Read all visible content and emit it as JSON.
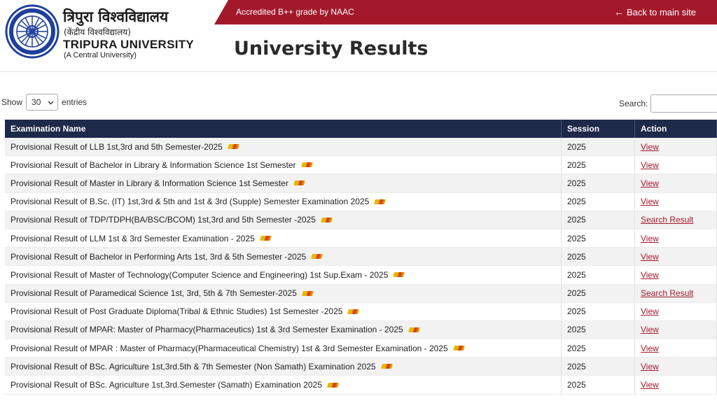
{
  "header": {
    "hindi_name": "त्रिपुरा विश्वविद्यालय",
    "hindi_sub": "(केंद्रीय विश्वविद्यालय)",
    "english_name": "TRIPURA UNIVERSITY",
    "english_sub": "(A Central University)",
    "naac": "Accredited B++ grade by NAAC",
    "back_label": "Back to main site",
    "page_title": "University Results"
  },
  "controls": {
    "show_label": "Show",
    "entries_value": "30",
    "entries_label": "entries",
    "search_label": "Search:"
  },
  "table": {
    "headers": [
      "Examination Name",
      "Session",
      "Action"
    ],
    "rows": [
      {
        "name": "Provisional Result of LLB 1st,3rd and 5th Semester-2025",
        "session": "2025",
        "action": "View"
      },
      {
        "name": "Provisional Result of Bachelor in Library & Information Science 1st Semester",
        "session": "2025",
        "action": "View"
      },
      {
        "name": "Provisional Result of Master in Library & Information Science 1st Semester",
        "session": "2025",
        "action": "View"
      },
      {
        "name": "Provisional Result of B.Sc. (IT) 1st,3rd & 5th and 1st & 3rd (Supple) Semester Examination 2025",
        "session": "2025",
        "action": "View"
      },
      {
        "name": "Provisional Result of TDP/TDPH(BA/BSC/BCOM) 1st,3rd and 5th Semester -2025",
        "session": "2025",
        "action": "Search Result"
      },
      {
        "name": "Provisional Result of LLM 1st & 3rd Semester Examination - 2025",
        "session": "2025",
        "action": "View"
      },
      {
        "name": "Provisional Result of Bachelor in Performing Arts 1st, 3rd & 5th Semester -2025",
        "session": "2025",
        "action": "View"
      },
      {
        "name": "Provisional Result of Master of Technology(Computer Science and Engineering) 1st Sup.Exam - 2025",
        "session": "2025",
        "action": "View"
      },
      {
        "name": "Provisional Result of Paramedical Science 1st, 3rd, 5th & 7th Semester-2025",
        "session": "2025",
        "action": "Search Result"
      },
      {
        "name": "Provisional Result of Post Graduate Diploma(Tribal & Ethnic Studies)  1st Semester -2025",
        "session": "2025",
        "action": "View"
      },
      {
        "name": "Provisional Result of MPAR: Master of Pharmacy(Pharmaceutics) 1st & 3rd Semester Examination - 2025",
        "session": "2025",
        "action": "View"
      },
      {
        "name": "Provisional Result of MPAR : Master of Pharmacy(Pharmaceutical Chemistry) 1st & 3rd Semester Examination - 2025",
        "session": "2025",
        "action": "View"
      },
      {
        "name": "Provisional Result of BSc. Agriculture 1st,3rd.5th & 7th Semester (Non Samath) Examination 2025",
        "session": "2025",
        "action": "View"
      },
      {
        "name": "Provisional Result of BSc. Agriculture 1st,3rd.Semester (Samath) Examination 2025",
        "session": "2025",
        "action": "View"
      }
    ]
  },
  "colors": {
    "brand_red": "#a3192b",
    "header_navy": "#1e2a4a"
  },
  "icons": {
    "logo": "university-seal-icon",
    "back": "arrow-left-icon",
    "new": "new-badge-icon"
  }
}
